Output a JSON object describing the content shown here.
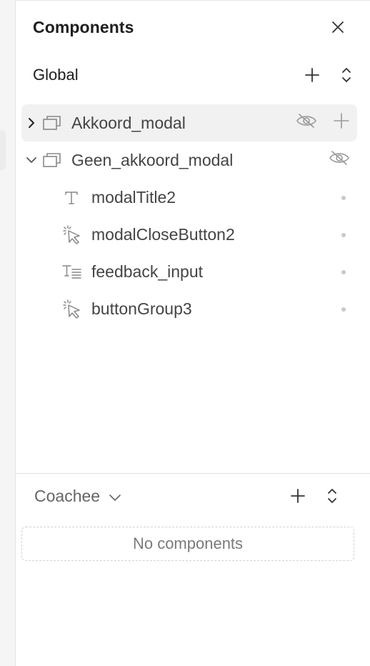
{
  "panel": {
    "title": "Components",
    "close_icon": "close-icon"
  },
  "global_section": {
    "label": "Global",
    "add_icon": "plus-icon",
    "expand_icon": "expand-collapse-icon",
    "items": [
      {
        "label": "Akkoord_modal",
        "type_icon": "frame-icon",
        "expanded": false,
        "selected": true,
        "actions": [
          "eye-off-icon",
          "plus-icon"
        ]
      },
      {
        "label": "Geen_akkoord_modal",
        "type_icon": "frame-icon",
        "expanded": true,
        "selected": false,
        "actions": [
          "eye-off-icon"
        ],
        "children": [
          {
            "label": "modalTitle2",
            "type_icon": "text-icon"
          },
          {
            "label": "modalCloseButton2",
            "type_icon": "cursor-click-icon"
          },
          {
            "label": "feedback_input",
            "type_icon": "text-input-icon"
          },
          {
            "label": "buttonGroup3",
            "type_icon": "cursor-click-icon"
          }
        ]
      }
    ]
  },
  "coachee_section": {
    "label": "Coachee",
    "dropdown_icon": "chevron-down-icon",
    "add_icon": "plus-icon",
    "expand_icon": "expand-collapse-icon",
    "empty_text": "No components"
  },
  "colors": {
    "selected_row_bg": "#f1f1f1",
    "icon_gray": "#777777",
    "text_dark": "#1e1e1e"
  }
}
